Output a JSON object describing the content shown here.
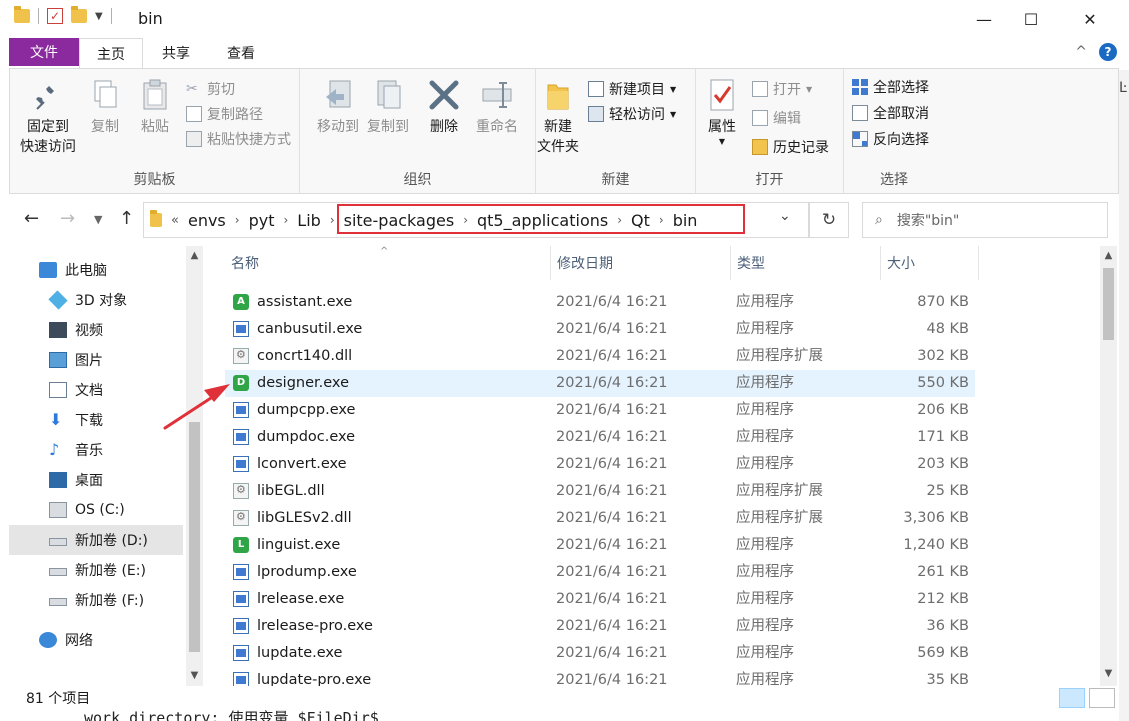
{
  "window": {
    "title": "bin",
    "minimize": "—",
    "maximize": "☐",
    "close": "✕"
  },
  "tabs": {
    "file": "文件",
    "home": "主页",
    "share": "共享",
    "view": "查看",
    "collapse": "^",
    "help": "?"
  },
  "ribbon": {
    "clipboard": {
      "label": "剪贴板",
      "pin": "固定到\n快速访问",
      "copy": "复制",
      "paste": "粘贴",
      "cut": "剪切",
      "copy_path": "复制路径",
      "paste_shortcut": "粘贴快捷方式"
    },
    "organize": {
      "label": "组织",
      "move_to": "移动到",
      "copy_to": "复制到",
      "delete": "删除",
      "rename": "重命名"
    },
    "new": {
      "label": "新建",
      "new_folder": "新建\n文件夹",
      "new_item": "新建项目",
      "easy_access": "轻松访问"
    },
    "open": {
      "label": "打开",
      "properties": "属性",
      "open": "打开",
      "edit": "编辑",
      "history": "历史记录"
    },
    "select": {
      "label": "选择",
      "select_all": "全部选择",
      "select_none": "全部取消",
      "invert": "反向选择"
    }
  },
  "address": {
    "overflow": "«",
    "crumbs": [
      "envs",
      "pyt",
      "Lib",
      "site-packages",
      "qt5_applications",
      "Qt",
      "bin"
    ],
    "search_placeholder": "搜索\"bin\""
  },
  "nav": {
    "items": [
      {
        "label": "此电脑",
        "icon": "computer-icon"
      },
      {
        "label": "3D 对象",
        "icon": "3d-objects-icon"
      },
      {
        "label": "视频",
        "icon": "video-icon"
      },
      {
        "label": "图片",
        "icon": "pictures-icon"
      },
      {
        "label": "文档",
        "icon": "documents-icon"
      },
      {
        "label": "下载",
        "icon": "download-icon"
      },
      {
        "label": "音乐",
        "icon": "music-icon"
      },
      {
        "label": "桌面",
        "icon": "desktop-icon"
      },
      {
        "label": "OS (C:)",
        "icon": "windows-drive-icon"
      },
      {
        "label": "新加卷 (D:)",
        "icon": "drive-icon"
      },
      {
        "label": "新加卷 (E:)",
        "icon": "drive-icon"
      },
      {
        "label": "新加卷 (F:)",
        "icon": "drive-icon"
      },
      {
        "label": "网络",
        "icon": "network-icon"
      }
    ]
  },
  "columns": {
    "name": "名称",
    "date": "修改日期",
    "type": "类型",
    "size": "大小"
  },
  "files": [
    {
      "name": "assistant.exe",
      "date": "2021/6/4 16:21",
      "type": "应用程序",
      "size": "870 KB",
      "icon": "qt-assistant-icon",
      "badge": "A"
    },
    {
      "name": "canbusutil.exe",
      "date": "2021/6/4 16:21",
      "type": "应用程序",
      "size": "48 KB",
      "icon": "exe-icon"
    },
    {
      "name": "concrt140.dll",
      "date": "2021/6/4 16:21",
      "type": "应用程序扩展",
      "size": "302 KB",
      "icon": "dll-icon"
    },
    {
      "name": "designer.exe",
      "date": "2021/6/4 16:21",
      "type": "应用程序",
      "size": "550 KB",
      "icon": "qt-designer-icon",
      "badge": "D"
    },
    {
      "name": "dumpcpp.exe",
      "date": "2021/6/4 16:21",
      "type": "应用程序",
      "size": "206 KB",
      "icon": "exe-icon"
    },
    {
      "name": "dumpdoc.exe",
      "date": "2021/6/4 16:21",
      "type": "应用程序",
      "size": "171 KB",
      "icon": "exe-icon"
    },
    {
      "name": "lconvert.exe",
      "date": "2021/6/4 16:21",
      "type": "应用程序",
      "size": "203 KB",
      "icon": "exe-icon"
    },
    {
      "name": "libEGL.dll",
      "date": "2021/6/4 16:21",
      "type": "应用程序扩展",
      "size": "25 KB",
      "icon": "dll-icon"
    },
    {
      "name": "libGLESv2.dll",
      "date": "2021/6/4 16:21",
      "type": "应用程序扩展",
      "size": "3,306 KB",
      "icon": "dll-icon"
    },
    {
      "name": "linguist.exe",
      "date": "2021/6/4 16:21",
      "type": "应用程序",
      "size": "1,240 KB",
      "icon": "qt-linguist-icon",
      "badge": "L"
    },
    {
      "name": "lprodump.exe",
      "date": "2021/6/4 16:21",
      "type": "应用程序",
      "size": "261 KB",
      "icon": "exe-icon"
    },
    {
      "name": "lrelease.exe",
      "date": "2021/6/4 16:21",
      "type": "应用程序",
      "size": "212 KB",
      "icon": "exe-icon"
    },
    {
      "name": "lrelease-pro.exe",
      "date": "2021/6/4 16:21",
      "type": "应用程序",
      "size": "36 KB",
      "icon": "exe-icon"
    },
    {
      "name": "lupdate.exe",
      "date": "2021/6/4 16:21",
      "type": "应用程序",
      "size": "569 KB",
      "icon": "exe-icon"
    },
    {
      "name": "lupdate-pro.exe",
      "date": "2021/6/4 16:21",
      "type": "应用程序",
      "size": "35 KB",
      "icon": "exe-icon"
    }
  ],
  "status": {
    "count": "81 个项目"
  },
  "background_text": "work directory: 使用变量 $FileDir$",
  "colors": {
    "file_tab": "#8b2a9e",
    "highlight_row": "#e5f3ff",
    "annotation_red": "#e0303a"
  }
}
